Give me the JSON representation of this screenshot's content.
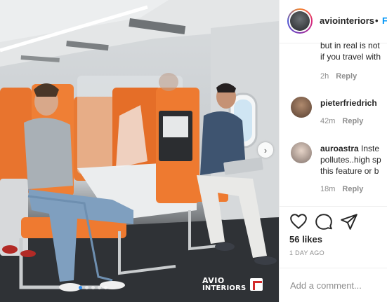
{
  "header": {
    "username": "aviointeriors",
    "separator": "•",
    "follow_label": "F"
  },
  "comments": [
    {
      "lines": [
        "but in real is not",
        "if you travel with"
      ],
      "time": "2h",
      "reply_label": "Reply"
    },
    {
      "username": "pieterfriedrich",
      "time": "42m",
      "reply_label": "Reply"
    },
    {
      "username": "auroastra",
      "text_line1": "Inste",
      "lines": [
        "pollutes..high sp",
        "this feature or b"
      ],
      "time": "18m",
      "reply_label": "Reply"
    }
  ],
  "actions": {
    "like_icon": "heart-icon",
    "comment_icon": "comment-icon",
    "share_icon": "paper-plane-icon",
    "likes": "56 likes",
    "posted": "1 DAY AGO"
  },
  "add_comment": {
    "placeholder": "Add a comment..."
  },
  "photo": {
    "brand_line1": "AVIO",
    "brand_line2": "INTERIORS",
    "carousel_next_icon": "chevron-right-icon",
    "carousel_index": 1,
    "carousel_total": 5
  },
  "colors": {
    "accent_blue": "#0095f6",
    "seat_orange": "#e8742e",
    "brand_red": "#d32a2a"
  }
}
